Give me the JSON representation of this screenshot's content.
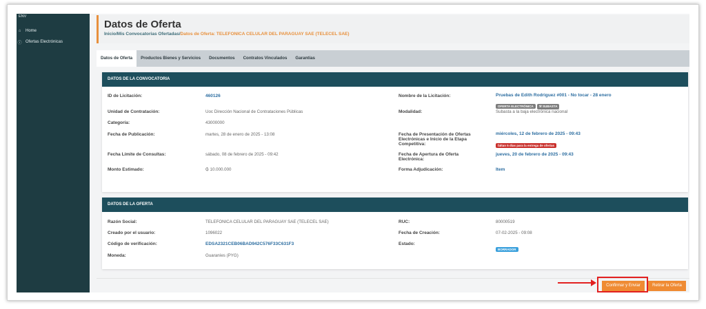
{
  "sidebar": {
    "env": "ENV",
    "items": [
      {
        "label": "Home",
        "icon": "home-icon"
      },
      {
        "label": "Ofertas Electrónicas",
        "icon": "info-circle-icon"
      }
    ]
  },
  "header": {
    "title": "Datos de Oferta",
    "breadcrumb_path": "Inicio/Mis Convocatorias Ofertadas/",
    "breadcrumb_current": "Datos de Oferta: TELEFONICA CELULAR DEL PARAGUAY SAE (TELECEL SAE)"
  },
  "tabs": [
    "Datos de Oferta",
    "Productos Bienes y Servicios",
    "Documentos",
    "Contratos Vinculados",
    "Garantías"
  ],
  "convocatoria": {
    "title": "DATOS DE LA CONVOCATORIA",
    "id_label": "ID de Licitación:",
    "id_value": "460126",
    "nombre_label": "Nombre de la Licitación:",
    "nombre_value": "Pruebas de Edith Rodriguez #001 - No tocar - 28 enero",
    "badge1": "OFERTA ELECTRÓNICA",
    "badge2": "SUBASTA",
    "unidad_label": "Unidad de Contratación:",
    "unidad_value": "Uoc Dirección Nacional de Contrataciones Públicas",
    "modalidad_label": "Modalidad:",
    "modalidad_value": "Subasta a la baja electrónica nacional",
    "categoria_label": "Categoría:",
    "categoria_value": "43000000",
    "fecha_pub_label": "Fecha de Publicación:",
    "fecha_pub_value": "martes, 28 de enero de 2025 - 13:08",
    "fecha_pres_label": "Fecha de Presentación de Ofertas Electrónicas e Inicio de la Etapa Competitiva:",
    "fecha_pres_value": "miércoles, 12 de febrero de 2025 - 09:43",
    "fecha_pres_badge": "faltan 5 días para la entrega de ofertas",
    "fecha_lim_label": "Fecha Límite de Consultas:",
    "fecha_lim_value": "sábado, 08 de febrero de 2025 - 09:42",
    "fecha_ap_label": "Fecha de Apertura de Oferta Electrónica:",
    "fecha_ap_value": "jueves, 20 de febrero de 2025 - 09:43",
    "monto_label": "Monto Estimado:",
    "monto_value": "₲ 10.000.000",
    "forma_label": "Forma Adjudicación:",
    "forma_value": "Item"
  },
  "oferta": {
    "title": "DATOS DE LA OFERTA",
    "razon_label": "Razón Social:",
    "razon_value": "TELEFONICA CELULAR DEL PARAGUAY SAE (TELECEL SAE)",
    "ruc_label": "RUC:",
    "ruc_value": "80000519",
    "creado_label": "Creado por el usuario:",
    "creado_value": "1096022",
    "fecha_cre_label": "Fecha de Creación:",
    "fecha_cre_value": "07-02-2025 - 09:08",
    "codigo_label": "Código de verificación:",
    "codigo_value": "EDSA2321CEB06BAD942C576F33C631F3",
    "estado_label": "Estado:",
    "estado_value": "BORRADOR",
    "moneda_label": "Moneda:",
    "moneda_value": "Guaraníes (PYG)"
  },
  "actions": {
    "confirm_label": "Confirmar y Enviar",
    "retirar_label": "Retirar la Oferta"
  },
  "colors": {
    "sidebar": "#1e3c42",
    "card_header": "#1d4e5c",
    "accent": "#ef8b33",
    "highlight": "#e21f1f"
  }
}
